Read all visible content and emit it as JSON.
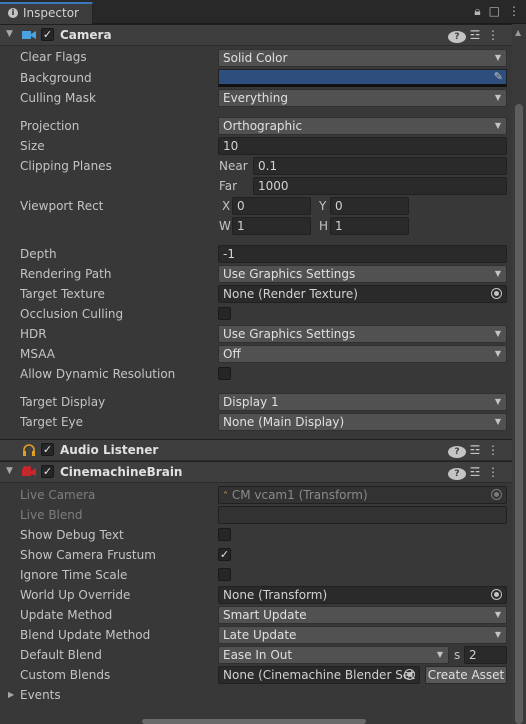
{
  "window": {
    "tab_label": "Inspector",
    "tab_icons": [
      "lock-icon",
      "maximize-icon",
      "menu-icon"
    ]
  },
  "camera": {
    "title": "Camera",
    "enabled": true,
    "clear_flags": {
      "label": "Clear Flags",
      "value": "Solid Color"
    },
    "background": {
      "label": "Background",
      "color": "#2e4f7e"
    },
    "culling_mask": {
      "label": "Culling Mask",
      "value": "Everything"
    },
    "projection": {
      "label": "Projection",
      "value": "Orthographic"
    },
    "size": {
      "label": "Size",
      "value": "10"
    },
    "clipping": {
      "label": "Clipping Planes",
      "near_label": "Near",
      "near": "0.1",
      "far_label": "Far",
      "far": "1000"
    },
    "viewport": {
      "label": "Viewport Rect",
      "x_label": "X",
      "x": "0",
      "y_label": "Y",
      "y": "0",
      "w_label": "W",
      "w": "1",
      "h_label": "H",
      "h": "1"
    },
    "depth": {
      "label": "Depth",
      "value": "-1"
    },
    "rendering_path": {
      "label": "Rendering Path",
      "value": "Use Graphics Settings"
    },
    "target_texture": {
      "label": "Target Texture",
      "value": "None (Render Texture)"
    },
    "occlusion_culling": {
      "label": "Occlusion Culling",
      "checked": false
    },
    "hdr": {
      "label": "HDR",
      "value": "Use Graphics Settings"
    },
    "msaa": {
      "label": "MSAA",
      "value": "Off"
    },
    "dynamic_resolution": {
      "label": "Allow Dynamic Resolution",
      "checked": false
    },
    "target_display": {
      "label": "Target Display",
      "value": "Display 1"
    },
    "target_eye": {
      "label": "Target Eye",
      "value": "None (Main Display)"
    }
  },
  "audio_listener": {
    "title": "Audio Listener",
    "enabled": true
  },
  "brain": {
    "title": "CinemachineBrain",
    "enabled": true,
    "live_camera": {
      "label": "Live Camera",
      "value": "CM vcam1 (Transform)"
    },
    "live_blend": {
      "label": "Live Blend",
      "value": ""
    },
    "show_debug_text": {
      "label": "Show Debug Text",
      "checked": false
    },
    "show_camera_frustum": {
      "label": "Show Camera Frustum",
      "checked": true
    },
    "ignore_time_scale": {
      "label": "Ignore Time Scale",
      "checked": false
    },
    "world_up_override": {
      "label": "World Up Override",
      "value": "None (Transform)"
    },
    "update_method": {
      "label": "Update Method",
      "value": "Smart Update"
    },
    "blend_update_method": {
      "label": "Blend Update Method",
      "value": "Late Update"
    },
    "default_blend": {
      "label": "Default Blend",
      "value": "Ease In Out",
      "s_label": "s",
      "seconds": "2"
    },
    "custom_blends": {
      "label": "Custom Blends",
      "value": "None (Cinemachine Blender Set",
      "create_button": "Create Asset"
    },
    "events": {
      "label": "Events"
    }
  },
  "checkmark": "✓",
  "colors": {
    "accent": "#3a79bb",
    "panel": "#383838",
    "field": "#2a2a2a",
    "dropdown": "#515151"
  }
}
